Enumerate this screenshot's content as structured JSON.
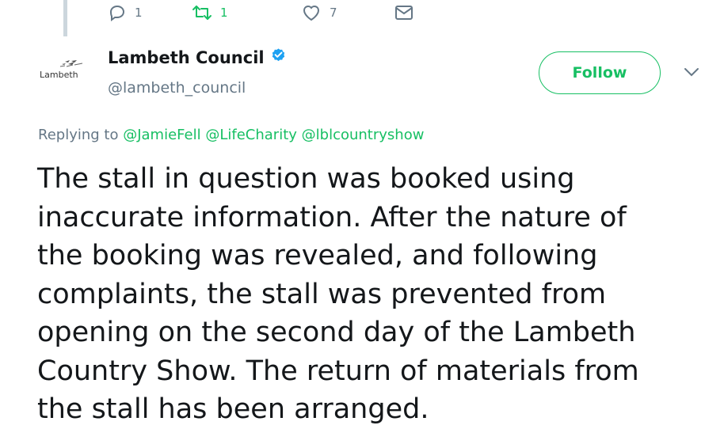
{
  "actions": {
    "reply_count": "1",
    "retweet_count": "1",
    "like_count": "7",
    "icons": [
      "reply-icon",
      "retweet-icon",
      "like-icon",
      "direct-message-icon"
    ]
  },
  "author": {
    "avatar_text": "Lambeth",
    "name": "Lambeth Council",
    "handle": "@lambeth_council",
    "verified": true
  },
  "follow_label": "Follow",
  "replying": {
    "prefix": "Replying to",
    "mentions": [
      "@JamieFell",
      "@LifeCharity",
      "@lblcountryshow"
    ]
  },
  "tweet": {
    "lines": [
      "The stall in question was booked using",
      "inaccurate information. After the nature of",
      "the booking was revealed, and following",
      "complaints, the stall was prevented from",
      "opening on the second day of the Lambeth",
      "Country Show. The return of materials from",
      "the stall has been arranged."
    ]
  },
  "colors": {
    "accent": "#17bf63",
    "verified": "#1da1f2",
    "secondary_text": "#657786",
    "primary_text": "#14171a"
  }
}
